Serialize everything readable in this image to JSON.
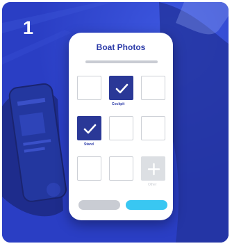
{
  "step": {
    "number": "1"
  },
  "phone": {
    "title": "Boat Photos",
    "photo_slots": [
      {
        "state": "empty",
        "caption": ""
      },
      {
        "state": "checked",
        "caption": "Cockpit"
      },
      {
        "state": "empty",
        "caption": ""
      },
      {
        "state": "checked",
        "caption": "Stand"
      },
      {
        "state": "empty",
        "caption": ""
      },
      {
        "state": "empty",
        "caption": ""
      },
      {
        "state": "empty",
        "caption": ""
      },
      {
        "state": "empty",
        "caption": ""
      },
      {
        "state": "add",
        "caption": "Other"
      }
    ],
    "cancel_button": "",
    "upload_button": ""
  },
  "colors": {
    "background_blue": "#2a3ec4",
    "title_blue": "#2b3aa8",
    "checked_tile": "#2a3897",
    "upload_button": "#39c7f2",
    "neutral_gray": "#c9ccd3"
  },
  "icons": {
    "checked_slot": "checkmark-icon",
    "add_slot": "plus-icon"
  }
}
